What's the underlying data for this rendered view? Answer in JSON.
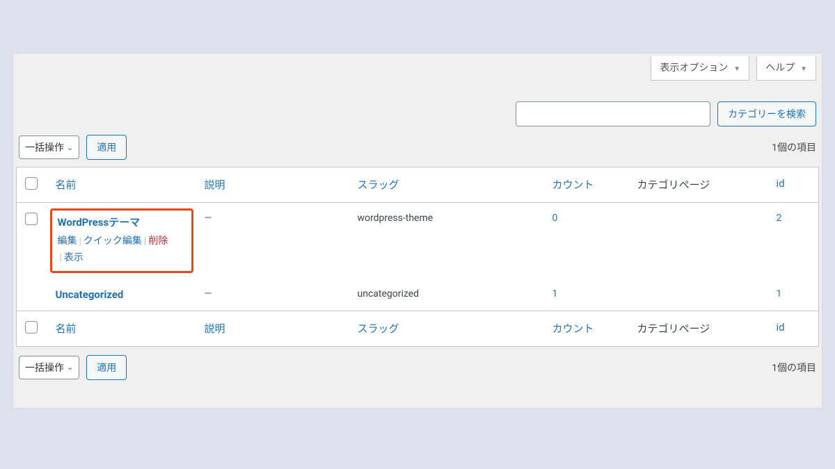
{
  "topButtons": {
    "screenOptions": "表示オプション",
    "help": "ヘルプ"
  },
  "search": {
    "value": "",
    "button": "カテゴリーを検索"
  },
  "bulk": {
    "selectLabel": "一括操作",
    "apply": "適用"
  },
  "itemsCount": "1個の項目",
  "columns": {
    "name": "名前",
    "description": "説明",
    "slug": "スラッグ",
    "count": "カウント",
    "categoryPage": "カテゴリページ",
    "id": "id"
  },
  "rowActions": {
    "edit": "編集",
    "quickEdit": "クイック編集",
    "delete": "削除",
    "view": "表示"
  },
  "rows": [
    {
      "title": "WordPressテーマ",
      "description": "—",
      "slug": "wordpress-theme",
      "count": "0",
      "categoryPage": "",
      "id": "2",
      "highlighted": true
    },
    {
      "title": "Uncategorized",
      "description": "—",
      "slug": "uncategorized",
      "count": "1",
      "categoryPage": "",
      "id": "1",
      "highlighted": false
    }
  ]
}
